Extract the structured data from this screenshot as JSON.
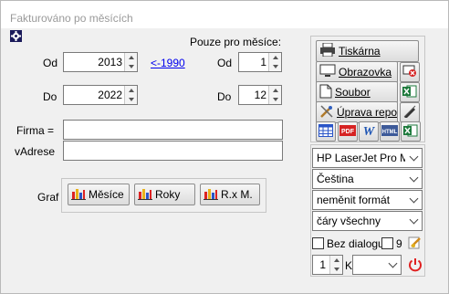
{
  "window": {
    "title": "Fakturováno po měsících"
  },
  "period": {
    "from_label": "Od",
    "from_year": "2013",
    "link_before_1990": "<-1990",
    "to_label": "Do",
    "to_year": "2022"
  },
  "months": {
    "heading": "Pouze pro měsíce:",
    "from_label": "Od",
    "from_month": "1",
    "to_label": "Do",
    "to_month": "12"
  },
  "filters": {
    "company_label": "Firma =",
    "company_value": "",
    "address_label": "vAdrese",
    "address_value": ""
  },
  "graph": {
    "label": "Graf",
    "buttons": [
      "Měsíce",
      "Roky",
      "R.x M."
    ]
  },
  "output": {
    "printer_label": "Tiskárna",
    "screen_label": "Obrazovka",
    "file_label": "Soubor",
    "edit_report_label": "Úprava repor"
  },
  "options": {
    "printer_select": "HP LaserJet Pro MFP",
    "language_select": "Čeština",
    "format_select": "neměnit formát",
    "lines_select": "čáry všechny",
    "no_dialog_label": "Bez dialogu",
    "nine_label": "9",
    "copies_value": "1",
    "copies_suffix": "K"
  },
  "colors": {
    "excel_green": "#1d7a3c",
    "pdf_red": "#d62222",
    "word_blue": "#1f56b4",
    "link_blue": "#0000ee",
    "power_red": "#e02020"
  }
}
